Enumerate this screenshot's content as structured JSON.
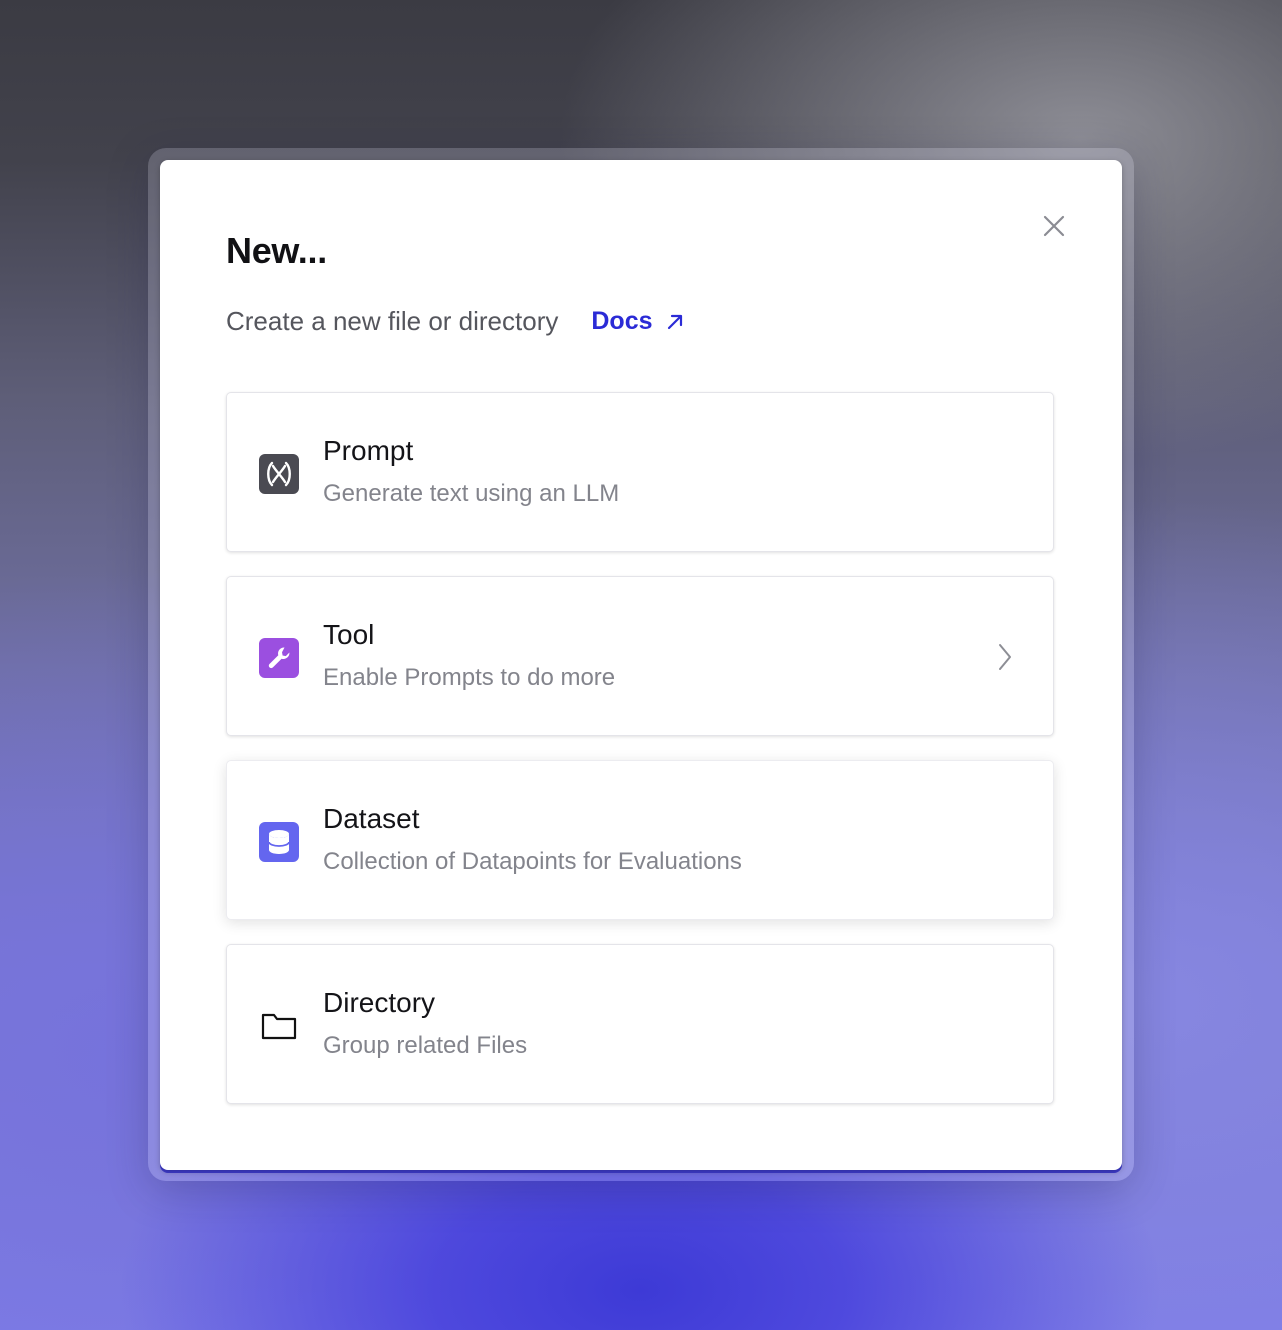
{
  "dialog": {
    "title": "New...",
    "subtitle": "Create a new file or directory",
    "docs_label": "Docs",
    "close_icon": "close-icon",
    "docs_icon": "external-arrow-icon"
  },
  "options": [
    {
      "title": "Prompt",
      "description": "Generate text using an LLM",
      "icon": "prompt-icon",
      "icon_color": "#4a4a52"
    },
    {
      "title": "Tool",
      "description": "Enable Prompts to do more",
      "icon": "wrench-icon",
      "icon_color": "#9b4fe0",
      "has_chevron": true
    },
    {
      "title": "Dataset",
      "description": "Collection of Datapoints for Evaluations",
      "icon": "database-icon",
      "icon_color": "#6466ef"
    },
    {
      "title": "Directory",
      "description": "Group related Files",
      "icon": "folder-icon",
      "icon_color": "#111111"
    }
  ],
  "colors": {
    "link": "#2b2bd6",
    "accent_bottom": "#3f3ccf"
  }
}
